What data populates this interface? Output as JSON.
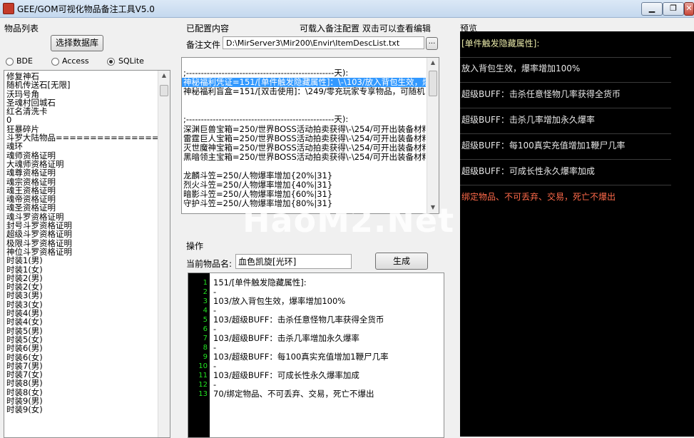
{
  "window": {
    "title": "GEE/GOM可视化物品备注工具V5.0",
    "buttons": [
      "▁",
      "❐",
      "✕"
    ]
  },
  "left": {
    "group_label": "物品列表",
    "select_db_button": "选择数据库",
    "db_types": [
      {
        "label": "BDE",
        "checked": false
      },
      {
        "label": "Access",
        "checked": false
      },
      {
        "label": "SQLite",
        "checked": true
      }
    ],
    "items": [
      "修复神石",
      "随机传送石[无限]",
      "沃玛号角",
      "圣魂村回城石",
      "红名清洗卡",
      "0",
      "狂暴碎片",
      "斗罗大陆物品================",
      "魂环",
      "魂师资格证明",
      "大魂师资格证明",
      "魂尊资格证明",
      "魂宗资格证明",
      "魂王资格证明",
      "魂帝资格证明",
      "魂圣资格证明",
      "魂斗罗资格证明",
      "封号斗罗资格证明",
      "超级斗罗资格证明",
      "极限斗罗资格证明",
      "神位斗罗资格证明",
      "时装1(男)",
      "时装1(女)",
      "时装2(男)",
      "时装2(女)",
      "时装3(男)",
      "时装3(女)",
      "时装4(男)",
      "时装4(女)",
      "时装5(男)",
      "时装5(女)",
      "时装6(男)",
      "时装6(女)",
      "时装7(男)",
      "时装7(女)",
      "时装8(男)",
      "时装8(女)",
      "时装9(男)",
      "时装9(女)"
    ]
  },
  "middle": {
    "configured_label": "已配置内容",
    "hint_label": "可载入备注配置  双击可以查看编辑",
    "file_label": "备注文件",
    "file_path": "D:\\MirServer3\\Mir200\\Envir\\ItemDescList.txt",
    "browse_button": "...",
    "config_lines": [
      {
        "text": ";--------------------------------------------------天):",
        "selected": false
      },
      {
        "text": "神秘福利凭证=151/[单件触发隐藏属性]：\\-\\103/放入背包生效，爆",
        "selected": true
      },
      {
        "text": "神秘福利盲盒=151/[双击使用]：\\249/零充玩家专享物品，可随机",
        "selected": false
      },
      {
        "text": "",
        "selected": false
      },
      {
        "text": "",
        "selected": false
      },
      {
        "text": ";--------------------------------------------------天):",
        "selected": false
      },
      {
        "text": "深渊巨兽宝箱=250/世界BOSS活动拍卖获得\\-\\254/可开出装备材料",
        "selected": false
      },
      {
        "text": "雷霆巨人宝箱=250/世界BOSS活动拍卖获得\\-\\254/可开出装备材料",
        "selected": false
      },
      {
        "text": "灭世魔神宝箱=250/世界BOSS活动拍卖获得\\-\\254/可开出装备材料",
        "selected": false
      },
      {
        "text": "黑暗领主宝箱=250/世界BOSS活动拍卖获得\\-\\254/可开出装备材料",
        "selected": false
      },
      {
        "text": "",
        "selected": false
      },
      {
        "text": "龙麟斗笠=250/人物爆率增加{20%|31}",
        "selected": false
      },
      {
        "text": "烈火斗笠=250/人物爆率增加{40%|31}",
        "selected": false
      },
      {
        "text": "暗影斗笠=250/人物爆率增加{60%|31}",
        "selected": false
      },
      {
        "text": "守护斗笠=250/人物爆率增加{80%|31}",
        "selected": false
      }
    ],
    "operate_label": "操作",
    "current_item_label": "当前物品名:",
    "current_item_value": "血色凯旋[光环]",
    "generate_button": "生成",
    "code_lines": [
      {
        "num": "1",
        "text": "151/[单件触发隐藏属性]:"
      },
      {
        "num": "2",
        "text": "-"
      },
      {
        "num": "3",
        "text": "103/放入背包生效，爆率增加100%"
      },
      {
        "num": "4",
        "text": "-"
      },
      {
        "num": "5",
        "text": "103/超级BUFF：击杀任意怪物几率获得全货币"
      },
      {
        "num": "6",
        "text": "-"
      },
      {
        "num": "7",
        "text": "103/超级BUFF：击杀几率增加永久爆率"
      },
      {
        "num": "8",
        "text": "-"
      },
      {
        "num": "9",
        "text": "103/超级BUFF：每100真实充值增加1鞭尸几率"
      },
      {
        "num": "10",
        "text": "-"
      },
      {
        "num": "11",
        "text": "103/超级BUFF：可成长性永久爆率加成"
      },
      {
        "num": "12",
        "text": "-"
      },
      {
        "num": "13",
        "text": "70/绑定物品、不可丢弃、交易，死亡不爆出"
      }
    ]
  },
  "preview": {
    "label": "预览",
    "lines": [
      {
        "text": "[单件触发隐藏属性]:",
        "color": "#e8e8a8"
      },
      {
        "text": "放入背包生效，爆率增加100%",
        "color": "#e8e8e8"
      },
      {
        "text": "超级BUFF：击杀任意怪物几率获得全货币",
        "color": "#e8e8e8"
      },
      {
        "text": "超级BUFF：击杀几率增加永久爆率",
        "color": "#e8e8e8"
      },
      {
        "text": "超级BUFF：每100真实充值增加1鞭尸几率",
        "color": "#e8e8e8"
      },
      {
        "text": "超级BUFF：可成长性永久爆率加成",
        "color": "#e8e8e8"
      },
      {
        "text": "绑定物品、不可丢弃、交易，死亡不爆出",
        "color": "#ff6a4a"
      }
    ]
  },
  "watermark": "HaoM2.Net"
}
